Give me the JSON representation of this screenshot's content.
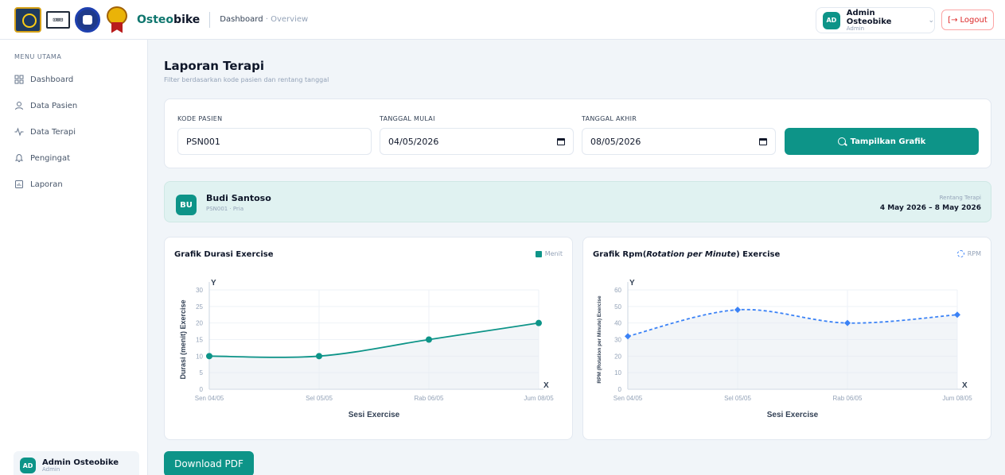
{
  "header": {
    "logo_2_text": "⊡⊠⊟",
    "brand_osteo": "Osteo",
    "brand_bike": "bike",
    "breadcrumb_main": "Dashboard",
    "breadcrumb_sub": "· Overview",
    "user": {
      "initials": "AD",
      "name": "Admin Osteobike",
      "role": "Admin"
    },
    "logout_label": "Logout"
  },
  "sidebar": {
    "section_title": "MENU UTAMA",
    "items": [
      {
        "label": "Dashboard",
        "icon": "grid-icon"
      },
      {
        "label": "Data Pasien",
        "icon": "user-icon"
      },
      {
        "label": "Data Terapi",
        "icon": "activity-icon"
      },
      {
        "label": "Pengingat",
        "icon": "bell-icon"
      },
      {
        "label": "Laporan",
        "icon": "report-icon"
      }
    ],
    "footer_user": {
      "initials": "AD",
      "name": "Admin Osteobike",
      "role": "Admin"
    }
  },
  "main": {
    "title": "Laporan Terapi",
    "subtitle": "Filter berdasarkan kode pasien dan rentang tanggal",
    "filter": {
      "patient_code_label": "KODE PASIEN",
      "patient_code_value": "PSN001",
      "start_label": "TANGGAL MULAI",
      "start_value": "04/05/2026",
      "end_label": "TANGGAL AKHIR",
      "end_value": "08/05/2026",
      "submit_label": "Tampilkan Grafik"
    },
    "patient": {
      "initials": "BU",
      "name": "Budi Santoso",
      "sub": "PSN001 · Pria",
      "range_label": "Rentang Terapi",
      "range_value": "4 May 2026 – 8 May 2026"
    },
    "download_label": "Download PDF"
  },
  "charts": {
    "duration": {
      "title": "Grafik Durasi Exercise",
      "legend": "Menit"
    },
    "rpm": {
      "title_pre": "Grafik Rpm(",
      "title_em": "Rotation per Minute",
      "title_post": ") Exercise",
      "legend": "RPM"
    }
  },
  "colors": {
    "accent": "#0d9488",
    "rpm_line": "#3b82f6",
    "danger": "#dc2626"
  },
  "chart_data": [
    {
      "type": "line",
      "title": "Grafik Durasi Exercise",
      "categories": [
        "Sen 04/05",
        "Sel 05/05",
        "Rab 06/05",
        "Jum 08/05"
      ],
      "series": [
        {
          "name": "Menit",
          "values": [
            10,
            10,
            15,
            20
          ]
        }
      ],
      "xlabel": "Sesi Exercise",
      "ylabel": "Durasi (menit) Exercise",
      "ylim": [
        0,
        30
      ],
      "yticks": [
        0,
        5,
        10,
        15,
        20,
        25,
        30
      ],
      "x_axis_letter": "X",
      "y_axis_letter": "Y",
      "grid": true,
      "area_fill": true
    },
    {
      "type": "line",
      "title": "Grafik Rpm(Rotation per Minute) Exercise",
      "categories": [
        "Sen 04/05",
        "Sel 05/05",
        "Rab 06/05",
        "Jum 08/05"
      ],
      "series": [
        {
          "name": "RPM",
          "values": [
            32,
            48,
            40,
            45
          ]
        }
      ],
      "xlabel": "Sesi Exercise",
      "ylabel": "RPM (Rotation per Minute) Exercise",
      "ylim": [
        0,
        60
      ],
      "yticks": [
        0,
        10,
        20,
        30,
        40,
        50,
        60
      ],
      "x_axis_letter": "X",
      "y_axis_letter": "Y",
      "grid": true,
      "dashed": true,
      "area_fill": true
    }
  ]
}
